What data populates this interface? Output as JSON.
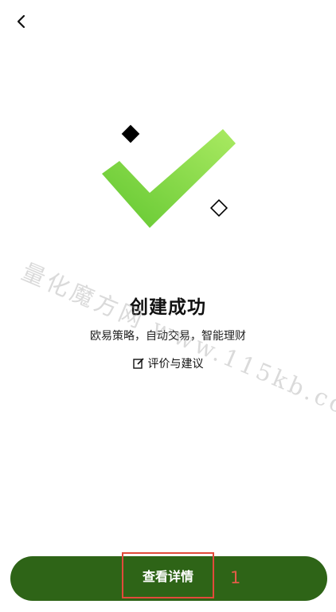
{
  "header": {
    "back_icon": "chevron-left-icon"
  },
  "result": {
    "title": "创建成功",
    "subtitle": "欧易策略，自动交易，智能理财",
    "feedback_label": "评价与建议",
    "feedback_icon": "edit-icon"
  },
  "colors": {
    "accent_green_light": "#9be255",
    "accent_green_dark": "#2e6417",
    "highlight_red": "#e24a3b"
  },
  "watermark": "量化魔方网 www.115kb.com",
  "footer": {
    "detail_button_label": "查看详情",
    "step_marker": "1"
  }
}
